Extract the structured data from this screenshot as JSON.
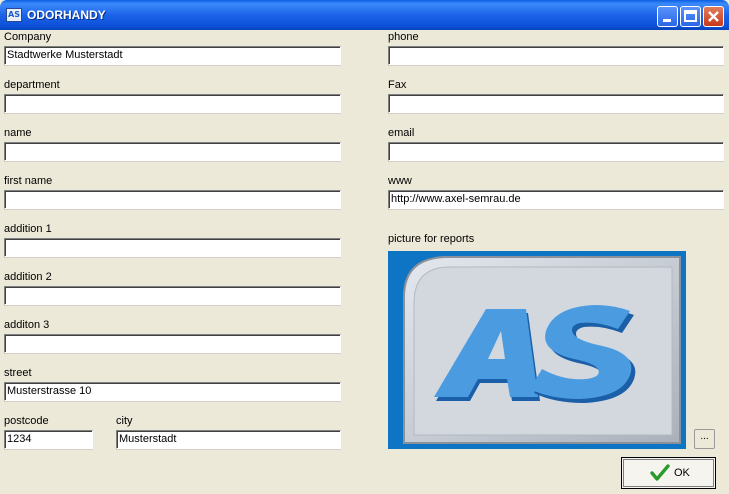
{
  "window": {
    "title": "ODORHANDY",
    "icon": "AS"
  },
  "titlebar_buttons": [
    "minimize-icon",
    "maximize-icon",
    "close-icon"
  ],
  "labels": {
    "company": "Company",
    "department": "department",
    "name": "name",
    "first_name": "first name",
    "addition1": "addition 1",
    "addition2": "addition 2",
    "addition3": "additon 3",
    "street": "street",
    "postcode": "postcode",
    "city": "city",
    "phone": "phone",
    "fax": "Fax",
    "email": "email",
    "www": "www",
    "picture": "picture for reports"
  },
  "values": {
    "company": "Stadtwerke Musterstadt",
    "department": "",
    "name": "",
    "first_name": "",
    "addition1": "",
    "addition2": "",
    "addition3": "",
    "street": "Musterstrasse 10",
    "postcode": "1234",
    "city": "Musterstadt",
    "phone": "",
    "fax": "",
    "email": "",
    "www": "http://www.axel-semrau.de"
  },
  "picture": {
    "logo_text": "AS",
    "colors": {
      "background": "#0e74c4",
      "frame": "#c9ced6",
      "letters": "#3e8edb"
    }
  },
  "buttons": {
    "browse": "...",
    "ok": "OK"
  },
  "colors": {
    "titlebar": "#1d63e9",
    "window_bg": "#ece9d8",
    "ok_check": "#2a9a2a"
  }
}
